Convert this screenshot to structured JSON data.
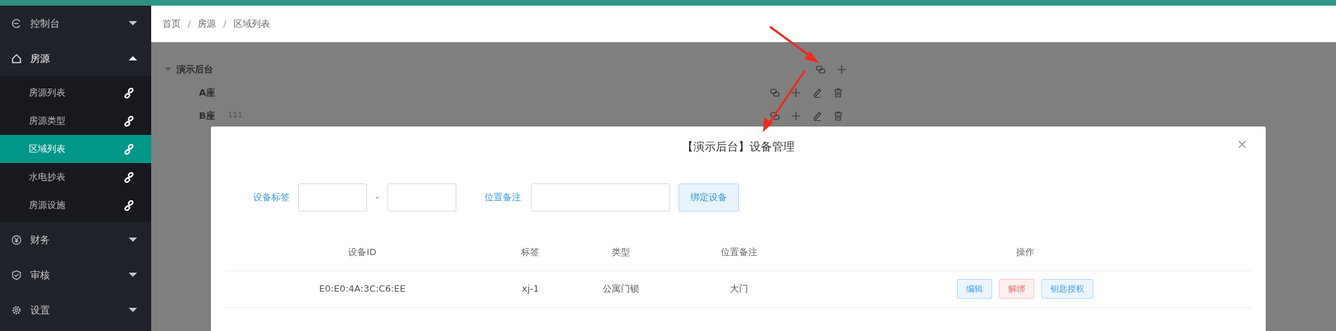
{
  "sidebar": {
    "items": [
      {
        "label": "控制台",
        "kind": "dashboard",
        "expanded": false
      },
      {
        "label": "房源",
        "kind": "home",
        "expanded": true,
        "children": [
          {
            "label": "房源列表",
            "selected": false
          },
          {
            "label": "房源类型",
            "selected": false
          },
          {
            "label": "区域列表",
            "selected": true
          },
          {
            "label": "水电抄表",
            "selected": false
          },
          {
            "label": "房源设施",
            "selected": false
          }
        ]
      },
      {
        "label": "财务",
        "kind": "finance",
        "expanded": false
      },
      {
        "label": "审核",
        "kind": "audit",
        "expanded": false
      },
      {
        "label": "设置",
        "kind": "settings",
        "expanded": false
      }
    ]
  },
  "breadcrumb": {
    "separator": "/",
    "items": [
      "首页",
      "房源",
      "区域列表"
    ]
  },
  "tree": [
    {
      "label": "演示后台",
      "expanded": true,
      "children": [
        {
          "label": "A座"
        },
        {
          "label": "B座",
          "note": "111"
        }
      ]
    }
  ],
  "modal": {
    "title": "【演示后台】设备管理",
    "close": "×",
    "form": {
      "tag_label": "设备标签",
      "separator": "-",
      "remark_label": "位置备注",
      "bind_button": "绑定设备"
    },
    "table": {
      "columns": [
        "设备ID",
        "标签",
        "类型",
        "位置备注",
        "操作"
      ],
      "rows": [
        {
          "cells": [
            "E0:E0:4A:3C:C6:EE",
            "xj-1",
            "公寓门锁",
            "大门"
          ],
          "actions": [
            {
              "label": "编辑",
              "kind": "primary"
            },
            {
              "label": "解绑",
              "kind": "danger"
            },
            {
              "label": "钥匙授权",
              "kind": "primary"
            }
          ]
        }
      ]
    }
  }
}
